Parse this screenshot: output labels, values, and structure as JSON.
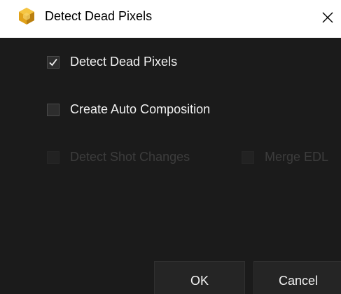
{
  "window": {
    "title": "Detect Dead Pixels",
    "app_icon": "hexagon-gold-icon",
    "close_icon": "close-x-icon"
  },
  "options": {
    "detect_dead_pixels": {
      "label": "Detect Dead Pixels",
      "checked": true,
      "enabled": true
    },
    "create_auto_composition": {
      "label": "Create Auto Composition",
      "checked": false,
      "enabled": true
    },
    "detect_shot_changes": {
      "label": "Detect Shot Changes",
      "checked": false,
      "enabled": false
    },
    "merge_edl": {
      "label": "Merge EDL",
      "checked": false,
      "enabled": false
    }
  },
  "buttons": {
    "ok_label": "OK",
    "cancel_label": "Cancel"
  },
  "colors": {
    "background": "#1b1b1b",
    "text": "#f2f2f2",
    "disabled_text": "#3c3c3c",
    "icon_gold": "#e1a21a"
  }
}
